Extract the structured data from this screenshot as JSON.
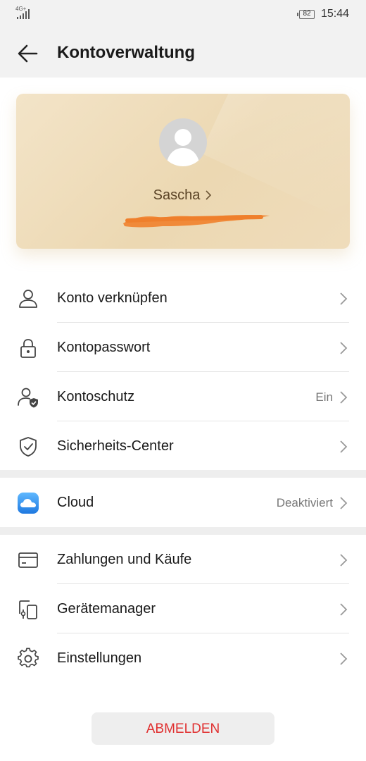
{
  "status_bar": {
    "network": "4G+",
    "battery": "82",
    "time": "15:44"
  },
  "app_bar": {
    "title": "Kontoverwaltung",
    "back_icon": "arrow-left-icon"
  },
  "profile": {
    "name": "Sascha",
    "avatar_icon": "user-silhouette-icon",
    "email_redacted": true
  },
  "sections": [
    {
      "items": [
        {
          "label": "Konto verknüpfen",
          "value": "",
          "icon": "person-icon"
        },
        {
          "label": "Kontopasswort",
          "value": "",
          "icon": "lock-icon"
        },
        {
          "label": "Kontoschutz",
          "value": "Ein",
          "icon": "person-shield-icon"
        },
        {
          "label": "Sicherheits-Center",
          "value": "",
          "icon": "shield-check-icon"
        }
      ]
    },
    {
      "items": [
        {
          "label": "Cloud",
          "value": "Deaktiviert",
          "icon": "cloud-icon"
        }
      ]
    },
    {
      "items": [
        {
          "label": "Zahlungen und Käufe",
          "value": "",
          "icon": "card-icon"
        },
        {
          "label": "Gerätemanager",
          "value": "",
          "icon": "devices-icon"
        },
        {
          "label": "Einstellungen",
          "value": "",
          "icon": "gear-icon"
        }
      ]
    }
  ],
  "logout": {
    "label": "ABMELDEN"
  },
  "colors": {
    "accent_red": "#e03030",
    "card_gold": "#ecd8b2",
    "cloud_blue": "#2f8fe8"
  }
}
